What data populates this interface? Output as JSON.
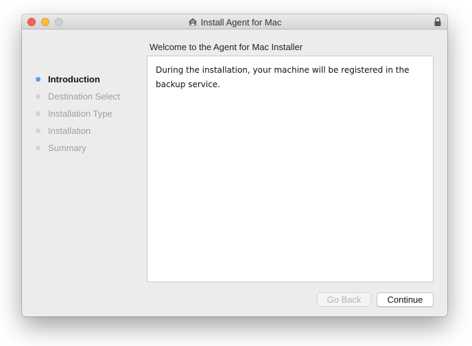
{
  "window": {
    "title": "Install Agent for Mac"
  },
  "heading": "Welcome to the Agent for Mac Installer",
  "steps": [
    {
      "label": "Introduction",
      "active": true
    },
    {
      "label": "Destination Select",
      "active": false
    },
    {
      "label": "Installation Type",
      "active": false
    },
    {
      "label": "Installation",
      "active": false
    },
    {
      "label": "Summary",
      "active": false
    }
  ],
  "content": {
    "text": "During the installation, your machine will be registered in the backup service."
  },
  "buttons": {
    "back_label": "Go Back",
    "continue_label": "Continue"
  },
  "icons": {
    "app": "installer-app-icon",
    "lock": "lock-icon"
  },
  "colors": {
    "active_step_dot": "#5a9ef5",
    "inactive_step_dot": "#d3d3d3",
    "close": "#fc605c",
    "minimize": "#fdbc40"
  }
}
